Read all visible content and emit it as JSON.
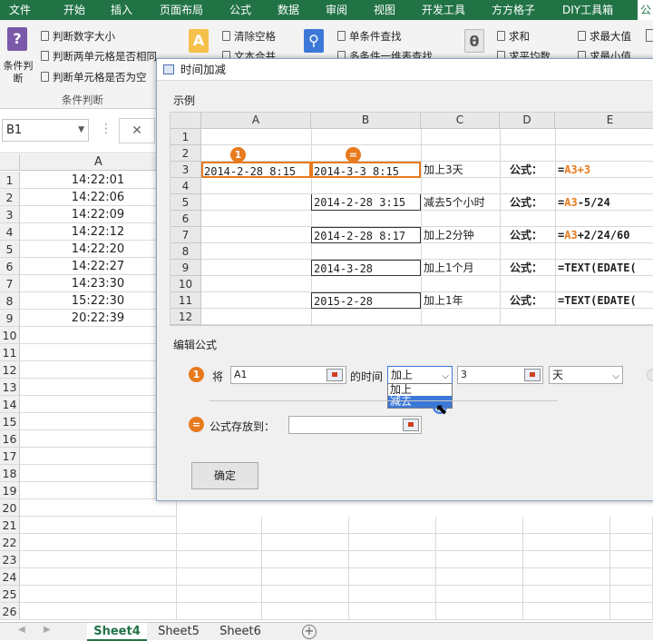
{
  "ribbon_tabs": [
    "文件",
    "开始",
    "插入",
    "页面布局",
    "公式",
    "数据",
    "审阅",
    "视图",
    "开发工具",
    "方方格子",
    "DIY工具箱",
    "公"
  ],
  "ribbon": {
    "group1_big_label": "条件判断",
    "group1_items": [
      "判断数字大小",
      "判断两单元格是否相同",
      "判断单元格是否为空"
    ],
    "group1_caption": "条件判断",
    "group2_items": [
      "清除空格",
      "文本合并"
    ],
    "group3_items": [
      "单条件查找",
      "多条件一维表查找"
    ],
    "group4_items": [
      "求和",
      "求平均数"
    ],
    "group5_items": [
      "求最大值",
      "求最小值"
    ]
  },
  "namebox": {
    "value": "B1",
    "cancel": "✕"
  },
  "sheet": {
    "col_header": "A",
    "rows": [
      {
        "n": "1",
        "a": "14:22:01"
      },
      {
        "n": "2",
        "a": "14:22:06"
      },
      {
        "n": "3",
        "a": "14:22:09"
      },
      {
        "n": "4",
        "a": "14:22:12"
      },
      {
        "n": "5",
        "a": "14:22:20"
      },
      {
        "n": "6",
        "a": "14:22:27"
      },
      {
        "n": "7",
        "a": "14:23:30"
      },
      {
        "n": "8",
        "a": "15:22:30"
      },
      {
        "n": "9",
        "a": "20:22:39"
      },
      {
        "n": "10",
        "a": ""
      },
      {
        "n": "11",
        "a": ""
      },
      {
        "n": "12",
        "a": ""
      },
      {
        "n": "13",
        "a": ""
      },
      {
        "n": "14",
        "a": ""
      },
      {
        "n": "15",
        "a": ""
      },
      {
        "n": "16",
        "a": ""
      },
      {
        "n": "17",
        "a": ""
      },
      {
        "n": "18",
        "a": ""
      },
      {
        "n": "19",
        "a": ""
      },
      {
        "n": "20",
        "a": ""
      },
      {
        "n": "21",
        "a": ""
      },
      {
        "n": "22",
        "a": ""
      },
      {
        "n": "23",
        "a": ""
      },
      {
        "n": "24",
        "a": ""
      },
      {
        "n": "25",
        "a": ""
      },
      {
        "n": "26",
        "a": ""
      }
    ]
  },
  "sheet_tabs": [
    "Sheet4",
    "Sheet5",
    "Sheet6"
  ],
  "active_sheet": "Sheet4",
  "dialog": {
    "title": "时间加减",
    "example_label": "示例",
    "example": {
      "cols": [
        "A",
        "B",
        "C",
        "D",
        "E"
      ],
      "rows": [
        "1",
        "2",
        "3",
        "4",
        "5",
        "6",
        "7",
        "8",
        "9",
        "10",
        "11",
        "12"
      ],
      "badge1": "1",
      "badge2": "=",
      "a3": "2014-2-28 8:15",
      "b3": "2014-3-3 8:15",
      "c3": "加上3天",
      "d3": "公式：",
      "e3_prefix": "=",
      "e3_orange": "A3+3",
      "b5": "2014-2-28 3:15",
      "c5": "减去5个小时",
      "d5": "公式：",
      "e5_prefix": "=",
      "e5_orange": "A3",
      "e5_suffix": "-5/24",
      "b7": "2014-2-28 8:17",
      "c7": "加上2分钟",
      "d7": "公式：",
      "e7_prefix": "=",
      "e7_orange": "A3",
      "e7_suffix": "+2/24/60",
      "b9": "2014-3-28",
      "c9": "加上1个月",
      "d9": "公式：",
      "e9": "=TEXT(EDATE(",
      "b11": "2015-2-28",
      "c11": "加上1年",
      "d11": "公式：",
      "e11": "=TEXT(EDATE("
    },
    "edit_label": "编辑公式",
    "step1_badge": "1",
    "step1_label": "将",
    "source_value": "A1",
    "time_label": "的时间",
    "op_selected": "加上",
    "op_options": [
      "加上",
      "减去"
    ],
    "op_highlighted": "减去",
    "amount_value": "3",
    "unit_value": "天",
    "step2_badge": "=",
    "store_label": "公式存放到：",
    "store_value": "",
    "ok_label": "确定"
  },
  "colors": {
    "excel_green": "#217346",
    "accent_orange": "#e87a1e",
    "selection_blue": "#3c78d8"
  }
}
